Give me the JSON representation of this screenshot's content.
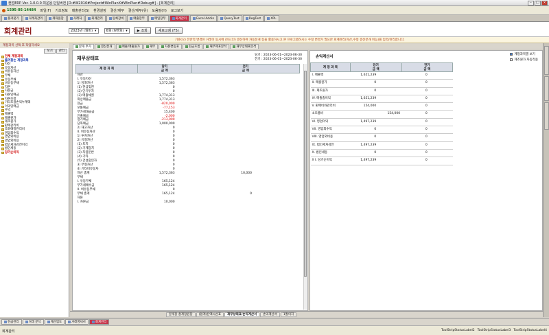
{
  "window": {
    "title": "캔덤ERP Ver. 1.0.0.0 미운용 단일버전  [D:#W2016#Project#WinPlanX#WinPlan#Debug#] - [회계관리]"
  },
  "menubar": {
    "phone": "1595-05-14484",
    "items": [
      "파일(F)",
      "기초정보",
      "매출관리(S)",
      "환경설정",
      "결산/재무",
      "결산/재무(유)",
      "도움말(H)",
      "로그보기"
    ]
  },
  "tabs": [
    "즐겨찾기",
    "거래처관리",
    "계좌원장",
    "거래처",
    "회계관리",
    "동록장비",
    "매출장부",
    "매입장부",
    "회계관리",
    "Excel Addin",
    "QueryTest",
    "RegTest",
    "XPL"
  ],
  "header": {
    "title": "회계관리",
    "year": "2023년 (월마)",
    "month": "6월 (6번월)",
    "search_button": "조회",
    "refresh_button": "새로고침 (F5)"
  },
  "notice": "기준(오) 전반적 변경된 거래이 동시에 진도(인) 결산하며 자동분개 등을 활용하시고 본 프로그램하시는 수정 변경가 필요한 회계관리(자산,수정 결산분개 비능)를 입력/관리합니다.",
  "sidebar": {
    "header": "계정과목 선택 후 작업하세요",
    "buttons": [
      "보기",
      "관리"
    ],
    "tree": [
      {
        "label": "전체 계정과목",
        "style": "red"
      },
      {
        "label": "즐겨찾는 계정과목",
        "style": "blue"
      },
      {
        "label": "자산",
        "style": ""
      },
      {
        "label": "  유동자산",
        "style": ""
      },
      {
        "label": "  비유동자산",
        "style": ""
      },
      {
        "label": "부채",
        "style": ""
      },
      {
        "label": "  유동부채",
        "style": ""
      },
      {
        "label": "  비유동부채",
        "style": ""
      },
      {
        "label": "자본",
        "style": ""
      },
      {
        "label": "  자본금",
        "style": ""
      },
      {
        "label": "  자본잉여금",
        "style": ""
      },
      {
        "label": "  자본조정",
        "style": ""
      },
      {
        "label": "  기타포괄손익누계액",
        "style": ""
      },
      {
        "label": "  이익잉여금",
        "style": ""
      },
      {
        "label": "수익",
        "style": ""
      },
      {
        "label": "  매출액",
        "style": ""
      },
      {
        "label": "  매출원가",
        "style": ""
      },
      {
        "label": "  제조원가",
        "style": ""
      },
      {
        "label": "  판매관리비",
        "style": ""
      },
      {
        "label": "  조회예정관리비",
        "style": ""
      },
      {
        "label": "  영업외수익",
        "style": ""
      },
      {
        "label": "  영업외비용",
        "style": ""
      },
      {
        "label": "  영업외비용",
        "style": ""
      },
      {
        "label": "  법인세차감전이익",
        "style": ""
      },
      {
        "label": "  법인세등",
        "style": ""
      },
      {
        "label": "당기순이익",
        "style": "red"
      }
    ]
  },
  "content_tabs": [
    "분개 추가",
    "결산분개",
    "매출/매출원가",
    "재무",
    "자본변동표",
    "현금흐름",
    "재무제표분석",
    "재무상태표분석"
  ],
  "balance_sheet": {
    "title": "재무상태표",
    "period_current": "당기 : 2023-06-01~2023-06-30",
    "period_prior": "전기 : 2023-06-01~2023-06-30",
    "col_current": "당기",
    "col_prior": "전기",
    "col_account": "계 정 과 목",
    "col_amount": "금 액",
    "rows": [
      {
        "n": "자산",
        "a": "",
        "b": "",
        "cls": ""
      },
      {
        "n": " I. 유동자산",
        "a": "1,572,363",
        "b": "",
        "cls": ""
      },
      {
        "n": "  1) 당좌자산",
        "a": "1,572,363",
        "b": "",
        "cls": ""
      },
      {
        "n": "   (1) 현금및현",
        "a": "0",
        "b": "",
        "cls": ""
      },
      {
        "n": "   (2) 단기투자",
        "a": "0",
        "b": "",
        "cls": ""
      },
      {
        "n": "   (3) 매출채권",
        "a": "1,774,313",
        "b": "",
        "cls": ""
      },
      {
        "n": "     외상매출금",
        "a": "1,774,313",
        "b": "",
        "cls": ""
      },
      {
        "n": "   현금",
        "a": "-820,000",
        "b": "",
        "cls": "neg"
      },
      {
        "n": "   보통예금",
        "a": "-77,153",
        "b": "",
        "cls": "neg"
      },
      {
        "n": "   부가세대급금",
        "a": "15,400",
        "b": "",
        "cls": ""
      },
      {
        "n": "   인출예금",
        "a": "-2,000",
        "b": "",
        "cls": "neg"
      },
      {
        "n": "   정기예금",
        "a": "-213,000",
        "b": "",
        "cls": "neg"
      },
      {
        "n": "   당좌예금",
        "a": "1,000,000",
        "b": "",
        "cls": ""
      },
      {
        "n": "  2) 재고자산",
        "a": "0",
        "b": "",
        "cls": ""
      },
      {
        "n": " II. 비유동자산",
        "a": "0",
        "b": "",
        "cls": ""
      },
      {
        "n": "  1) 투자자산",
        "a": "0",
        "b": "",
        "cls": ""
      },
      {
        "n": "  2) 유형자산",
        "a": "0",
        "b": "",
        "cls": ""
      },
      {
        "n": "   (1) 토지",
        "a": "0",
        "b": "",
        "cls": ""
      },
      {
        "n": "   (2) 기계장치",
        "a": "0",
        "b": "",
        "cls": ""
      },
      {
        "n": "   (3) 차량운반",
        "a": "0",
        "b": "",
        "cls": ""
      },
      {
        "n": "   (4) 기타",
        "a": "0",
        "b": "",
        "cls": ""
      },
      {
        "n": "   (5) 건설중인자",
        "a": "0",
        "b": "",
        "cls": ""
      },
      {
        "n": "  3) 무형자산",
        "a": "0",
        "b": "",
        "cls": ""
      },
      {
        "n": "  4) 기타비유동자",
        "a": "0",
        "b": "",
        "cls": ""
      },
      {
        "n": "자산 총계",
        "a": "1,572,363",
        "b": "10,000",
        "cls": ""
      },
      {
        "n": "부채",
        "a": "",
        "b": "",
        "cls": ""
      },
      {
        "n": " I. 유동부채",
        "a": "165,124",
        "b": "",
        "cls": ""
      },
      {
        "n": "   부가세예수금",
        "a": "165,124",
        "b": "",
        "cls": ""
      },
      {
        "n": " II. 비유동부채",
        "a": "0",
        "b": "",
        "cls": ""
      },
      {
        "n": "부채 총계",
        "a": "165,124",
        "b": "0",
        "cls": ""
      },
      {
        "n": "자본",
        "a": "",
        "b": "",
        "cls": ""
      },
      {
        "n": " I. 자본금",
        "a": "10,000",
        "b": "",
        "cls": ""
      }
    ]
  },
  "income_statement": {
    "title": "손익계산서",
    "options": [
      "계정과목별 보기",
      "제조원가 자동적용"
    ],
    "col_account": "계 정 과 목",
    "col_current": "당기",
    "col_prior": "전기",
    "col_amount": "금 액",
    "rows": [
      {
        "n": "I. 매출액",
        "a": "1,651,239",
        "m": "",
        "b": "0"
      },
      {
        "n": "II. 매출원가",
        "a": "0",
        "m": "",
        "b": "0"
      },
      {
        "n": "III. 제조원가",
        "a": "0",
        "m": "",
        "b": "0"
      },
      {
        "n": "IV. 매출총이익",
        "a": "1,651,239",
        "m": "",
        "b": "0"
      },
      {
        "n": "V. 판매비와관리비",
        "a": "154,000",
        "m": "",
        "b": "0"
      },
      {
        "n": "   소모품비",
        "a": "",
        "m": "154,000",
        "b": "0"
      },
      {
        "n": "VI. 영업이익",
        "a": "1,497,239",
        "m": "",
        "b": "0"
      },
      {
        "n": "VII. 영업외수익",
        "a": "0",
        "m": "",
        "b": "0"
      },
      {
        "n": "VIII. 영업외비용",
        "a": "0",
        "m": "",
        "b": "0"
      },
      {
        "n": "IX. 법인세차감전",
        "a": "1,497,239",
        "m": "",
        "b": "0"
      },
      {
        "n": "X. 법인세등",
        "a": "0",
        "m": "",
        "b": "0"
      },
      {
        "n": "X I. 당기순이익",
        "a": "1,497,239",
        "m": "",
        "b": "0"
      }
    ]
  },
  "bottom_tabs": [
    "분개장 총계정원장",
    "(합계)잔액시산표",
    "재무상태표/손익계산서",
    "손익계산서",
    "1월이지"
  ],
  "task_tabs": [
    "현금관리",
    "거래 분석",
    "계산업도",
    "거래명세서",
    "회계관리"
  ],
  "status": {
    "left": "회계관리",
    "labels": [
      "ToolStripStatusLabel2",
      "ToolStripStatusLabel3",
      "ToolStripStatusLabel4"
    ]
  }
}
